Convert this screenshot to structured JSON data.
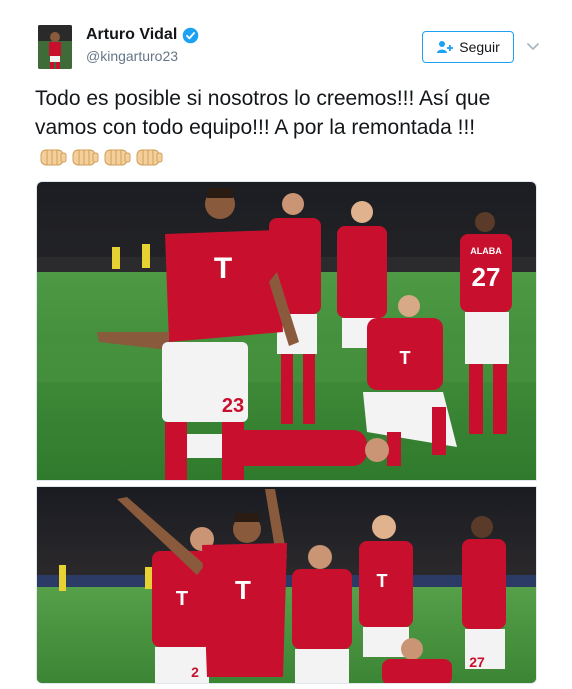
{
  "user": {
    "name": "Arturo Vidal",
    "handle": "@kingarturo23",
    "verified": true
  },
  "follow_button": {
    "label": "Seguir",
    "icon": "add-user-icon"
  },
  "menu_icon": "chevron-down-icon",
  "tweet": {
    "text": "Todo es posible si nosotros lo creemos!!! Así que vamos con todo equipo!!! A por la remontada !!!",
    "emoji_count": 4,
    "emoji_icon": "fist-bump-icon"
  },
  "photos": [
    {
      "jersey_numbers": [
        "23",
        "27"
      ],
      "player_name": "ALABA"
    },
    {
      "jersey_numbers": [
        "27",
        "2"
      ]
    }
  ],
  "colors": {
    "brand_blue": "#1da1f2",
    "jersey_red": "#c8102e",
    "pitch_green": "#3f8a3a",
    "text_gray": "#657786"
  }
}
